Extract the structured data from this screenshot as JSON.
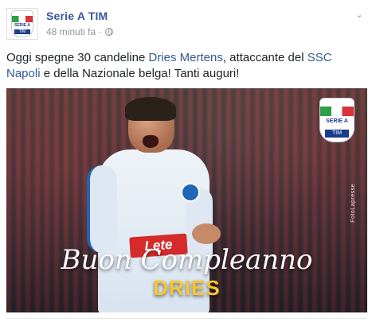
{
  "post": {
    "page_name": "Serie A TIM",
    "timestamp": "48 minuti fa",
    "separator": "·",
    "chevron_icon": "chevron-down-icon",
    "privacy_icon": "globe-icon",
    "text_parts": [
      "Oggi spegne 30 candeline ",
      "Dries Mertens",
      ", attaccante del ",
      "SSC Napoli",
      " e della Nazionale belga! Tanti auguri!"
    ]
  },
  "image": {
    "sponsor": "Lete",
    "logo_text": "SERIE A",
    "logo_sub": "TIM",
    "credit": "FotoLapresse",
    "headline": "Buon Compleanno",
    "name": "DRIES"
  },
  "colors": {
    "link": "#365899",
    "meta": "#90949c",
    "headline": "#ffffff",
    "name": "#f6c531"
  }
}
